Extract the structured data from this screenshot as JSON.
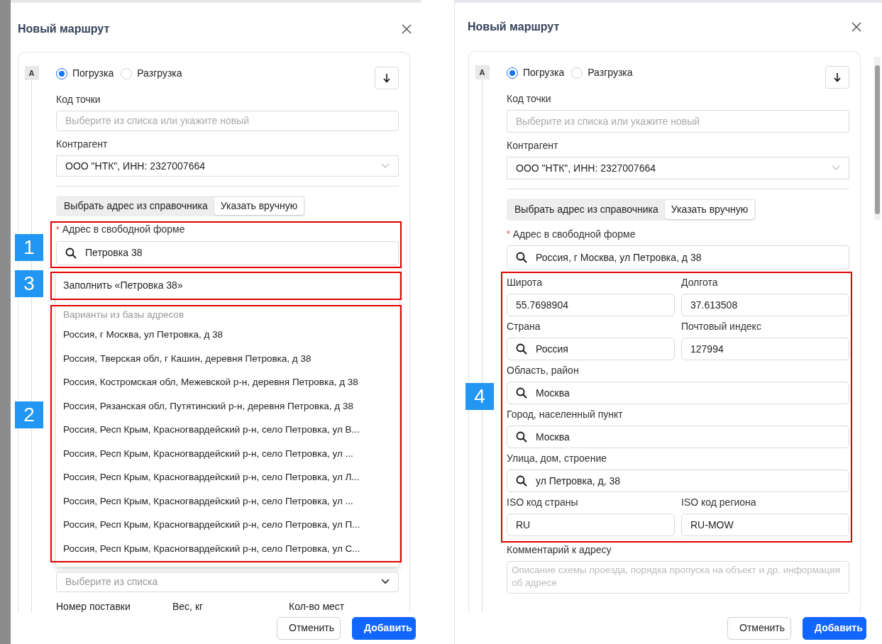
{
  "panels": [
    {
      "title": "Новый маршрут",
      "point_letter": "A",
      "operation": [
        {
          "label": "Погрузка",
          "selected": true
        },
        {
          "label": "Разгрузка",
          "selected": false
        }
      ],
      "point_code": {
        "label": "Код точки",
        "placeholder": "Выберите из списка или укажите новый"
      },
      "counterparty": {
        "label": "Контрагент",
        "value": "ООО \"НТК\", ИНН: 2327007664"
      },
      "address_source": [
        {
          "label": "Выбрать адрес из справочника",
          "selected": false
        },
        {
          "label": "Указать вручную",
          "selected": true
        }
      ],
      "address": {
        "label": "Адрес в свободной форме",
        "required_mark": "*",
        "value": "Петровка 38",
        "annotation": "1"
      },
      "dropdown": {
        "fill_option": {
          "label": "Заполнить «Петровка 38»",
          "annotation": "3"
        },
        "suggestions": {
          "annotation": "2",
          "header": "Варианты из базы адресов",
          "options": [
            "Россия, г Москва, ул Петровка, д 38",
            "Россия, Тверская обл, г Кашин, деревня Петровка, д 38",
            "Россия, Костромская обл, Межевской р-н, деревня Петровка, д 38",
            "Россия, Рязанская обл, Путятинский р-н, деревня Петровка, д 38",
            "Россия, Респ Крым, Красногвардейский р-н, село Петровка, ул В...",
            "Россия, Респ Крым, Красногвардейский р-н, село Петровка, ул ...",
            "Россия, Респ Крым, Красногвардейский р-н, село Петровка, ул Л...",
            "Россия, Респ Крым, Красногвардейский р-н, село Петровка, ул ...",
            "Россия, Респ Крым, Красногвардейский р-н, село Петровка, ул П...",
            "Россия, Респ Крым, Красногвардейский р-н, село Петровка, ул С..."
          ]
        }
      },
      "select": {
        "placeholder": "Выберите из списка"
      },
      "columns": [
        "Номер поставки",
        "Вес, кг",
        "Кол-во мест"
      ],
      "buttons": [
        {
          "label": "Отменить",
          "kind": "secondary"
        },
        {
          "label": "Добавить",
          "kind": "primary"
        }
      ]
    },
    {
      "title": "Новый маршрут",
      "point_letter": "A",
      "operation": [
        {
          "label": "Погрузка",
          "selected": true
        },
        {
          "label": "Разгрузка",
          "selected": false
        }
      ],
      "point_code": {
        "label": "Код точки",
        "placeholder": "Выберите из списка или укажите новый"
      },
      "counterparty": {
        "label": "Контрагент",
        "value": "ООО \"НТК\", ИНН: 2327007664"
      },
      "address_source": [
        {
          "label": "Выбрать адрес из справочника",
          "selected": false
        },
        {
          "label": "Указать вручную",
          "selected": true
        }
      ],
      "address": {
        "label": "Адрес в свободной форме",
        "required_mark": "*",
        "value": "Россия, г Москва, ул Петровка, д 38"
      },
      "details": {
        "annotation": "4",
        "rows": [
          [
            {
              "label": "Широта",
              "value": "55.7698904",
              "search": false
            },
            {
              "label": "Долгота",
              "value": "37.613508",
              "search": false
            }
          ],
          [
            {
              "label": "Страна",
              "value": "Россия",
              "search": true
            },
            {
              "label": "Почтовый индекс",
              "value": "127994",
              "search": false
            }
          ],
          [
            {
              "label": "Область, район",
              "value": "Москва",
              "search": true
            }
          ],
          [
            {
              "label": "Город, населенный пункт",
              "value": "Москва",
              "search": true
            }
          ],
          [
            {
              "label": "Улица, дом, строение",
              "value": "ул Петровка, д, 38",
              "search": true
            }
          ],
          [
            {
              "label": "ISO код страны",
              "value": "RU",
              "search": false
            },
            {
              "label": "ISO код региона",
              "value": "RU-MOW",
              "search": false
            }
          ]
        ]
      },
      "comment": {
        "label": "Комментарий к адресу",
        "placeholder": "Описание схемы проезда, порядка пропуска на объект и др. информация об адресе"
      },
      "buttons": [
        {
          "label": "Отменить",
          "kind": "secondary"
        },
        {
          "label": "Добавить",
          "kind": "primary"
        }
      ]
    }
  ]
}
